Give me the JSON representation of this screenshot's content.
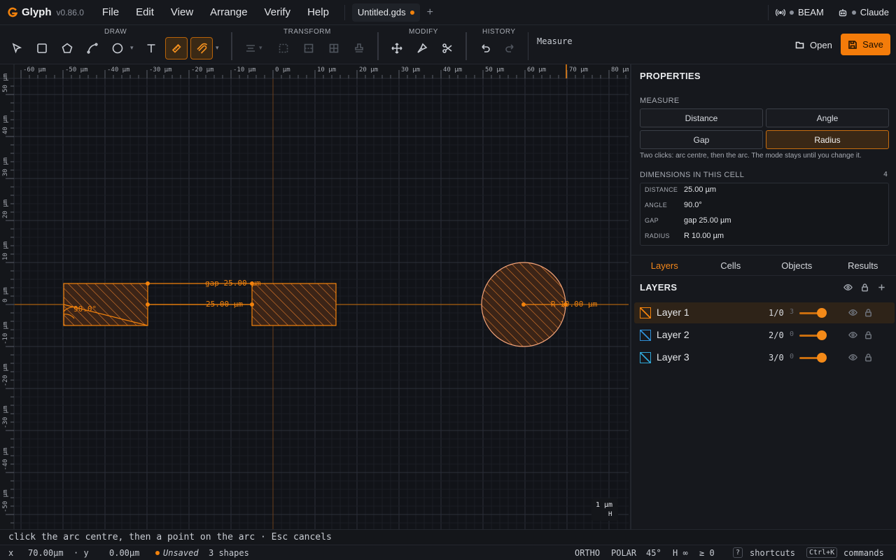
{
  "app": {
    "name": "Glyph",
    "version": "v0.86.0",
    "brand_color": "#f47c0a"
  },
  "menu": [
    "File",
    "Edit",
    "View",
    "Arrange",
    "Verify",
    "Help"
  ],
  "tab": {
    "name": "Untitled.gds",
    "new_tab_glyph": "+"
  },
  "right_items": [
    {
      "icon": "broadcast-icon",
      "label": "BEAM"
    },
    {
      "icon": "robot-icon",
      "label": "Claude"
    }
  ],
  "toolbar": {
    "groups": {
      "draw": "DRAW",
      "transform": "TRANSFORM",
      "modify": "MODIFY",
      "history": "HISTORY"
    },
    "measure_label": "Measure",
    "open_label": "Open",
    "save_label": "Save"
  },
  "canvas": {
    "x_ticks": [
      "-60 µm",
      "-50 µm",
      "-40 µm",
      "-30 µm",
      "-20 µm",
      "-10 µm",
      "0 µm",
      "10 µm",
      "20 µm",
      "30 µm",
      "40 µm",
      "50 µm",
      "60 µm",
      "70 µm",
      "80 µm"
    ],
    "y_ticks": [
      "50 µm",
      "40 µm",
      "30 µm",
      "20 µm",
      "10 µm",
      "0 µm",
      "-10 µm",
      "-20 µm",
      "-30 µm",
      "-40 µm",
      "-50 µm"
    ],
    "labels": {
      "gap": "gap 25.00 µm",
      "distance": "25.00 µm",
      "angle": "90.0°",
      "radius": "R 10.00 µm"
    },
    "scale": {
      "value": "1 µm",
      "axis": "H"
    }
  },
  "properties": {
    "title": "PROPERTIES",
    "measure_title": "MEASURE",
    "modes": [
      "Distance",
      "Angle",
      "Gap",
      "Radius"
    ],
    "active_mode": "Radius",
    "hint": "Two clicks: arc centre, then the arc. The mode stays until you change it.",
    "dims_title": "DIMENSIONS IN THIS CELL",
    "dims_count": "4",
    "dims": [
      {
        "key": "DISTANCE",
        "value": "25.00 µm"
      },
      {
        "key": "ANGLE",
        "value": "90.0°"
      },
      {
        "key": "GAP",
        "value": "gap 25.00 µm"
      },
      {
        "key": "RADIUS",
        "value": "R 10.00 µm"
      }
    ]
  },
  "panel_tabs": [
    "Layers",
    "Cells",
    "Objects",
    "Results"
  ],
  "active_panel_tab": "Layers",
  "layers": {
    "title": "LAYERS",
    "items": [
      {
        "name": "Layer 1",
        "count": "1/0",
        "num": "3",
        "color": "#f2820c",
        "opacity": 1.0
      },
      {
        "name": "Layer 2",
        "count": "2/0",
        "num": "0",
        "color": "#2f8fd6",
        "opacity": 1.0
      },
      {
        "name": "Layer 3",
        "count": "3/0",
        "num": "0",
        "color": "#2fa6d6",
        "opacity": 1.0
      }
    ]
  },
  "hint_bar": "click the arc centre, then a point on the arc · Esc cancels",
  "status": {
    "x_label": "x",
    "x_value": "70.00µm",
    "y_label": "· y",
    "y_value": "0.00µm",
    "unsaved": "Unsaved",
    "shapes": "3 shapes",
    "ortho": "ORTHO",
    "polar": "POLAR",
    "angle": "45°",
    "h": "H ∞",
    "ge": "≥ 0",
    "shortcuts_key": "?",
    "shortcuts": "shortcuts",
    "commands_key": "Ctrl+K",
    "commands": "commands"
  }
}
